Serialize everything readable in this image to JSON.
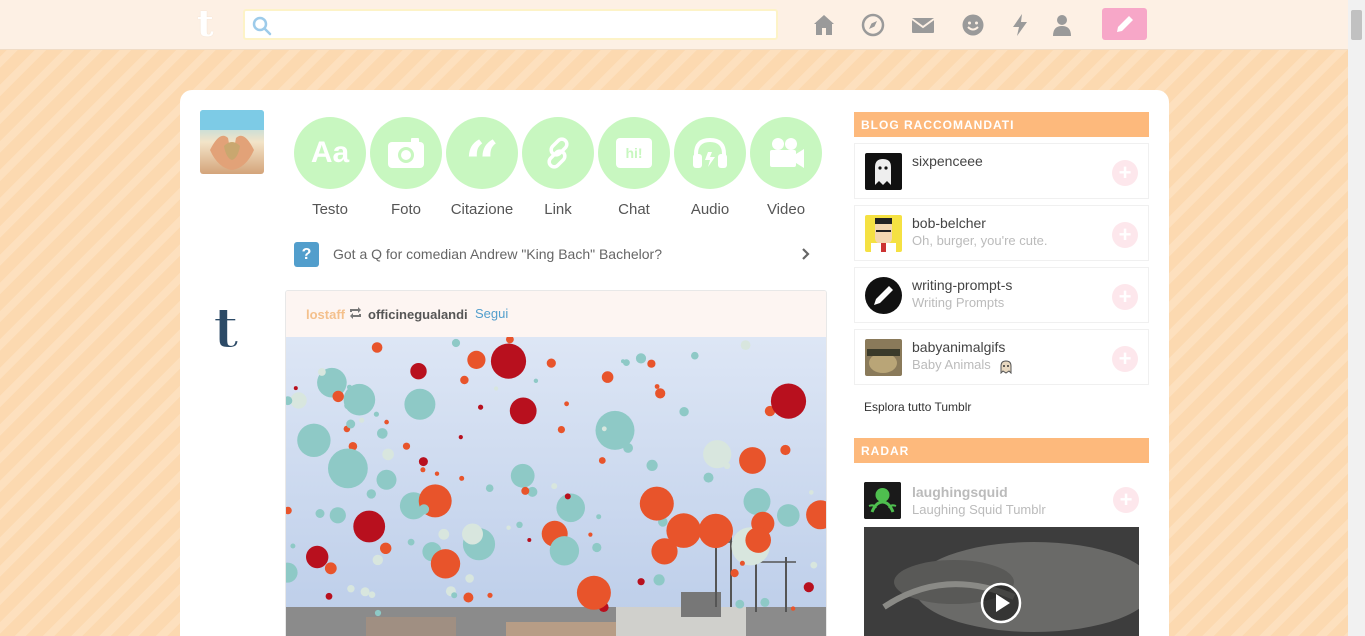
{
  "search": {
    "placeholder": "",
    "value": ""
  },
  "nav": {
    "icons": [
      "home-icon",
      "explore-icon",
      "messages-icon",
      "activity-icon",
      "lightning-icon",
      "account-icon"
    ],
    "compose_icon": "pencil-icon"
  },
  "post_types": [
    {
      "label": "Testo",
      "glyph": "Aa"
    },
    {
      "label": "Foto",
      "glyph": "camera"
    },
    {
      "label": "Citazione",
      "glyph": "“"
    },
    {
      "label": "Link",
      "glyph": "link"
    },
    {
      "label": "Chat",
      "glyph": "hi!"
    },
    {
      "label": "Audio",
      "glyph": "headphones"
    },
    {
      "label": "Video",
      "glyph": "camcorder"
    }
  ],
  "qa_bar": {
    "icon": "?",
    "text": "Got a Q for comedian Andrew \"King Bach\" Bachelor?"
  },
  "post": {
    "author": "lostaff",
    "source": "officinegualandi",
    "follow": "Segui"
  },
  "recommended": {
    "title": "Blog raccomandati",
    "items": [
      {
        "name": "sixpenceee",
        "subtitle": ""
      },
      {
        "name": "bob-belcher",
        "subtitle": "Oh, burger, you're cute."
      },
      {
        "name": "writing-prompt-s",
        "subtitle": "Writing Prompts"
      },
      {
        "name": "babyanimalgifs",
        "subtitle": "Baby Animals"
      }
    ],
    "explore": "Esplora tutto Tumblr"
  },
  "radar": {
    "title": "Radar",
    "name": "laughingsquid",
    "subtitle": "Laughing Squid Tumblr"
  },
  "colors": {
    "accent_orange": "#fdb97c",
    "post_type_green": "#c8f7c0",
    "compose_pink": "#f7a7c8",
    "link_blue": "#529ecc"
  }
}
